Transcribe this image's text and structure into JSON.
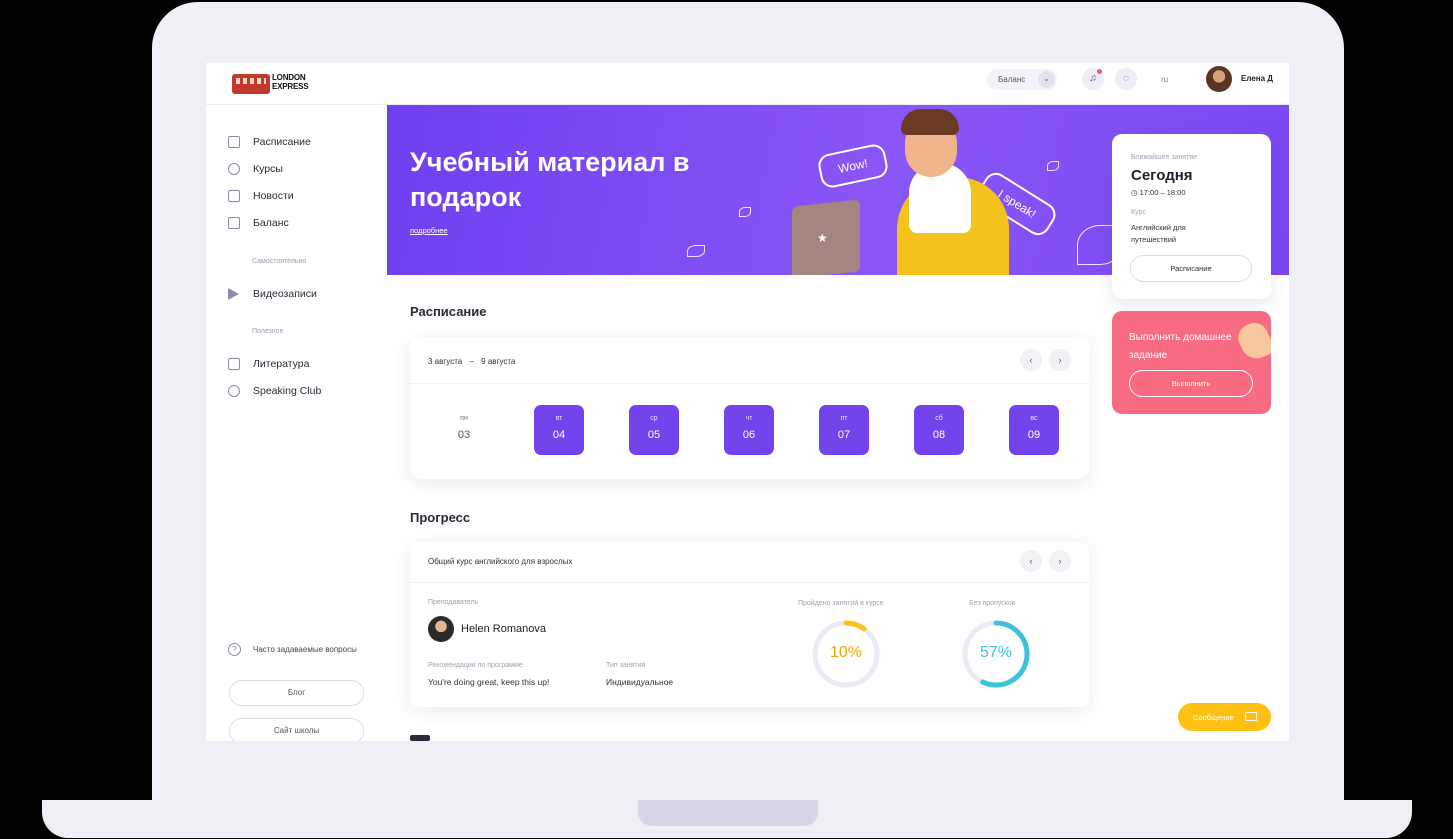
{
  "logo": {
    "line1": "LONDON",
    "line2": "EXPRESS"
  },
  "topbar": {
    "balance_label": "Баланс",
    "chevron": "⌄",
    "bell_icon": "♫",
    "chat_icon": "◌",
    "lang": "ru",
    "username": "Елена Д"
  },
  "sidebar": {
    "items_main": [
      {
        "label": "Расписание",
        "icon": "calendar-icon"
      },
      {
        "label": "Курсы",
        "icon": "rocket-icon"
      },
      {
        "label": "Новости",
        "icon": "news-icon"
      },
      {
        "label": "Баланс",
        "icon": "wallet-icon"
      }
    ],
    "section_self": "Самостоятельно",
    "item_video": "Видеозаписи",
    "section_useful": "Полезное",
    "item_literature": "Литература",
    "item_speaking": "Speaking Club",
    "faq": "Часто задаваемые вопросы",
    "faq_icon": "?",
    "blog": "Блог",
    "school_site": "Сайт школы"
  },
  "banner": {
    "title": "Учебный материал в подарок",
    "link": "подробнее",
    "bubble1": "Wow!",
    "bubble2": "I speak!",
    "star": "★"
  },
  "next_lesson": {
    "caption": "Ближайшее занятие",
    "day": "Сегодня",
    "time": "◷ 17:00 – 18:00",
    "course_caption": "Курс",
    "course": "Английский для путешествий",
    "button": "Расписание"
  },
  "homework": {
    "title": "Выполнить домашнее задание",
    "button": "Выполнить"
  },
  "schedule": {
    "title": "Расписание",
    "range_start": "3 августа",
    "range_sep": "–",
    "range_end": "9 августа",
    "prev": "‹",
    "next": "›",
    "days": [
      {
        "name": "пн",
        "date": "03",
        "active": false
      },
      {
        "name": "вт",
        "date": "04",
        "active": true
      },
      {
        "name": "ср",
        "date": "05",
        "active": true
      },
      {
        "name": "чт",
        "date": "06",
        "active": true
      },
      {
        "name": "пт",
        "date": "07",
        "active": true
      },
      {
        "name": "сб",
        "date": "08",
        "active": true
      },
      {
        "name": "вс",
        "date": "09",
        "active": true
      }
    ]
  },
  "progress": {
    "title": "Прогресс",
    "course": "Общий курс английского для взрослых",
    "prev": "‹",
    "next": "›",
    "teacher_caption": "Преподаватель",
    "teacher": "Helen Romanova",
    "recommend_caption": "Рекомендации по программе",
    "recommend": "You're doing great, keep this up!",
    "type_caption": "Тип занятия",
    "type": "Индивидуальное",
    "completed_caption": "Пройдено занятий в курсе",
    "completed_label": "10%",
    "completed_value": 0.1,
    "completed_color": "#fdc013",
    "attendance_caption": "Без пропусков",
    "attendance_label": "57%",
    "attendance_value": 0.57,
    "attendance_color": "#3ec3dc",
    "track_color": "#e9ebf5"
  },
  "message_button": "Сообщение"
}
